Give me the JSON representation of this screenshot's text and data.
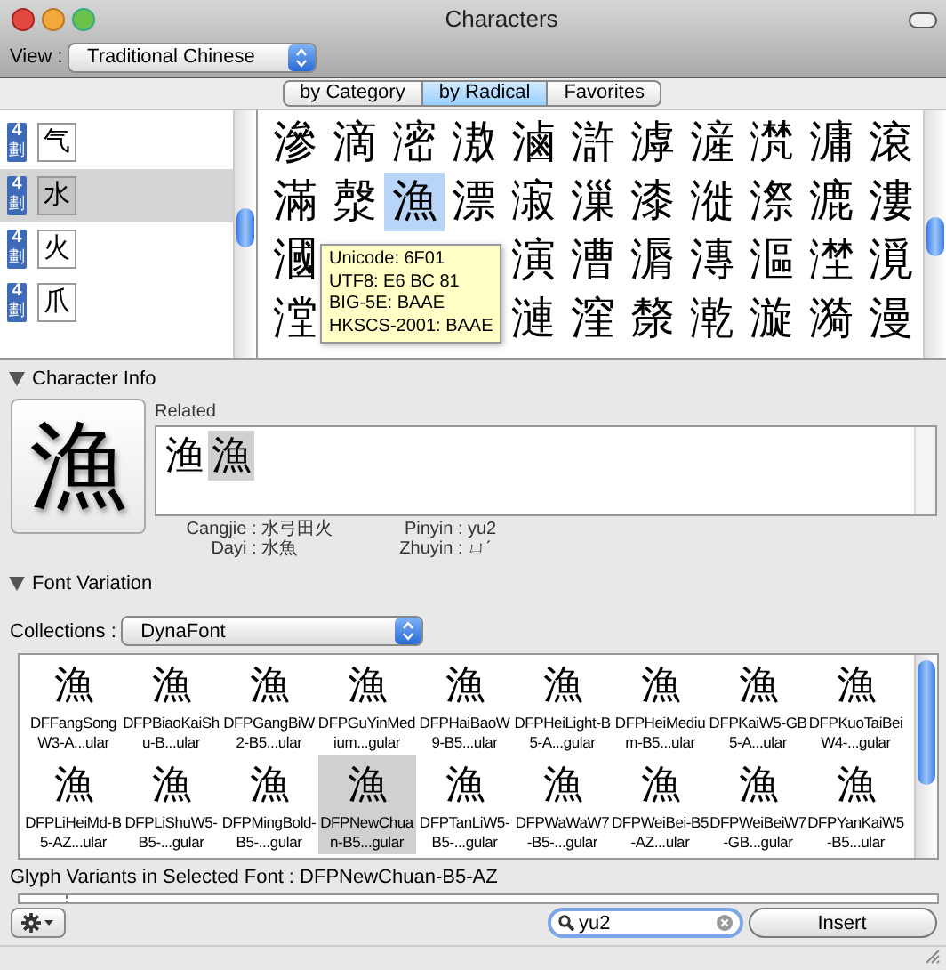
{
  "window": {
    "title": "Characters"
  },
  "view": {
    "label": "View :",
    "value": "Traditional Chinese"
  },
  "tabs": [
    {
      "label": "by Category",
      "selected": false
    },
    {
      "label": "by Radical",
      "selected": true
    },
    {
      "label": "Favorites",
      "selected": false
    }
  ],
  "radicals": [
    {
      "strokes": "4",
      "unit": "劃",
      "char": "气",
      "selected": false
    },
    {
      "strokes": "4",
      "unit": "劃",
      "char": "水",
      "selected": true
    },
    {
      "strokes": "4",
      "unit": "劃",
      "char": "火",
      "selected": false
    },
    {
      "strokes": "4",
      "unit": "劃",
      "char": "爪",
      "selected": false
    }
  ],
  "character_rows": [
    [
      {
        "kind": "char",
        "char": "滲",
        "selected": false
      },
      {
        "kind": "char",
        "char": "滴",
        "selected": false
      },
      {
        "kind": "char",
        "char": "滵",
        "selected": false
      },
      {
        "kind": "char",
        "char": "滶",
        "selected": false
      },
      {
        "kind": "char",
        "char": "滷",
        "selected": false
      },
      {
        "kind": "char",
        "char": "滸",
        "selected": false
      },
      {
        "kind": "char",
        "char": "滹",
        "selected": false
      },
      {
        "kind": "char",
        "char": "滻",
        "selected": false
      },
      {
        "kind": "char",
        "char": "滼",
        "selected": false
      },
      {
        "kind": "char",
        "char": "滽",
        "selected": false
      },
      {
        "kind": "char",
        "char": "滾",
        "selected": false
      }
    ],
    [
      {
        "kind": "char",
        "char": "滿",
        "selected": false
      },
      {
        "kind": "char",
        "char": "漀",
        "selected": false
      },
      {
        "kind": "char",
        "char": "漁",
        "selected": true
      },
      {
        "kind": "char",
        "char": "漂",
        "selected": false
      },
      {
        "kind": "char",
        "char": "漃",
        "selected": false
      },
      {
        "kind": "char",
        "char": "漅",
        "selected": false
      },
      {
        "kind": "char",
        "char": "漆",
        "selected": false
      },
      {
        "kind": "char",
        "char": "漇",
        "selected": false
      },
      {
        "kind": "char",
        "char": "漈",
        "selected": false
      },
      {
        "kind": "char",
        "char": "漉",
        "selected": false
      },
      {
        "kind": "char",
        "char": "漊",
        "selected": false
      }
    ],
    [
      {
        "kind": "char",
        "char": "漍",
        "selected": false
      },
      {
        "kind": "covered"
      },
      {
        "kind": "covered"
      },
      {
        "kind": "covered"
      },
      {
        "kind": "char",
        "char": "演",
        "selected": false
      },
      {
        "kind": "char",
        "char": "漕",
        "selected": false
      },
      {
        "kind": "char",
        "char": "漘",
        "selected": false
      },
      {
        "kind": "char",
        "char": "漙",
        "selected": false
      },
      {
        "kind": "char",
        "char": "漚",
        "selected": false
      },
      {
        "kind": "char",
        "char": "漜",
        "selected": false
      },
      {
        "kind": "char",
        "char": "漞",
        "selected": false
      }
    ],
    [
      {
        "kind": "char",
        "char": "漟",
        "selected": false
      },
      {
        "kind": "covered"
      },
      {
        "kind": "covered"
      },
      {
        "kind": "covered"
      },
      {
        "kind": "char",
        "char": "漣",
        "selected": false
      },
      {
        "kind": "char",
        "char": "漥",
        "selected": false
      },
      {
        "kind": "char",
        "char": "漦",
        "selected": false
      },
      {
        "kind": "char",
        "char": "漧",
        "selected": false
      },
      {
        "kind": "char",
        "char": "漩",
        "selected": false
      },
      {
        "kind": "char",
        "char": "漪",
        "selected": false
      },
      {
        "kind": "char",
        "char": "漫",
        "selected": false
      }
    ]
  ],
  "tooltip": {
    "lines": [
      "Unicode: 6F01",
      "UTF8: E6 BC 81",
      "BIG-5E: BAAE",
      "HKSCS-2001: BAAE"
    ]
  },
  "character_info": {
    "heading": "Character Info",
    "expanded": true,
    "glyph": "漁",
    "related_label": "Related",
    "related": [
      {
        "char": "渔",
        "selected": false
      },
      {
        "char": "漁",
        "selected": true
      }
    ],
    "fields": [
      {
        "label": "Cangjie :",
        "value": "水弓田火"
      },
      {
        "label": "Pinyin :",
        "value": "yu2"
      },
      {
        "label": "Dayi :",
        "value": "水魚"
      },
      {
        "label": "Zhuyin :",
        "value": "ㄩˊ"
      }
    ]
  },
  "font_variation": {
    "heading": "Font Variation",
    "expanded": true,
    "collections_label": "Collections :",
    "collection": "DynaFont",
    "fonts": [
      {
        "glyph": "漁",
        "name": "DFFangSongW3-A...ular",
        "selected": false
      },
      {
        "glyph": "漁",
        "name": "DFPBiaoKaiShu-B...ular",
        "selected": false
      },
      {
        "glyph": "漁",
        "name": "DFPGangBiW2-B5...ular",
        "selected": false
      },
      {
        "glyph": "漁",
        "name": "DFPGuYinMedium...gular",
        "selected": false
      },
      {
        "glyph": "漁",
        "name": "DFPHaiBaoW9-B5...ular",
        "selected": false
      },
      {
        "glyph": "漁",
        "name": "DFPHeiLight-B5-A...gular",
        "selected": false
      },
      {
        "glyph": "漁",
        "name": "DFPHeiMedium-B5...ular",
        "selected": false
      },
      {
        "glyph": "漁",
        "name": "DFPKaiW5-GB5-A...ular",
        "selected": false
      },
      {
        "glyph": "漁",
        "name": "DFPKuoTaiBeiW4-...gular",
        "selected": false
      },
      {
        "glyph": "漁",
        "name": "DFPLiHeiMd-B5-AZ...ular",
        "selected": false
      },
      {
        "glyph": "漁",
        "name": "DFPLiShuW5-B5-...gular",
        "selected": false
      },
      {
        "glyph": "漁",
        "name": "DFPMingBold-B5-...gular",
        "selected": false
      },
      {
        "glyph": "漁",
        "name": "DFPNewChuan-B5...gular",
        "selected": true
      },
      {
        "glyph": "漁",
        "name": "DFPTanLiW5-B5-...gular",
        "selected": false
      },
      {
        "glyph": "漁",
        "name": "DFPWaWaW7-B5-...gular",
        "selected": false
      },
      {
        "glyph": "漁",
        "name": "DFPWeiBei-B5-AZ...ular",
        "selected": false
      },
      {
        "glyph": "漁",
        "name": "DFPWeiBeiW7-GB...gular",
        "selected": false
      },
      {
        "glyph": "漁",
        "name": "DFPYanKaiW5-B5...ular",
        "selected": false
      }
    ]
  },
  "glyph_variants": {
    "label": "Glyph Variants in Selected Font :",
    "font": "DFPNewChuan-B5-AZ"
  },
  "search": {
    "value": "yu2"
  },
  "insert_button": "Insert"
}
